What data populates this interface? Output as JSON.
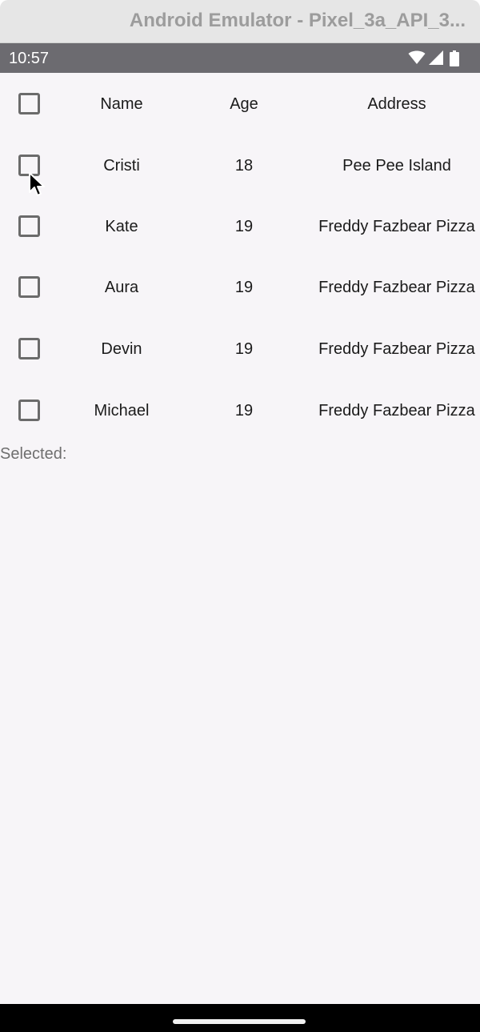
{
  "window": {
    "title": "Android Emulator - Pixel_3a_API_3..."
  },
  "status_bar": {
    "time": "10:57",
    "icons": [
      "wifi-icon",
      "cellular-signal-icon",
      "battery-icon"
    ]
  },
  "table": {
    "columns": [
      "Name",
      "Age",
      "Address"
    ],
    "rows": [
      {
        "name": "Cristi",
        "age": "18",
        "address": "Pee Pee Island"
      },
      {
        "name": "Kate",
        "age": "19",
        "address": "Freddy Fazbear Pizza"
      },
      {
        "name": "Aura",
        "age": "19",
        "address": "Freddy Fazbear Pizza"
      },
      {
        "name": "Devin",
        "age": "19",
        "address": "Freddy Fazbear Pizza"
      },
      {
        "name": "Michael",
        "age": "19",
        "address": "Freddy Fazbear Pizza"
      }
    ]
  },
  "selected_label": "Selected:",
  "colors": {
    "background": "#f7f5f8",
    "status_bar": "#6c6b70",
    "checkbox_border": "#6b6b6b",
    "nav_bar": "#000000"
  }
}
